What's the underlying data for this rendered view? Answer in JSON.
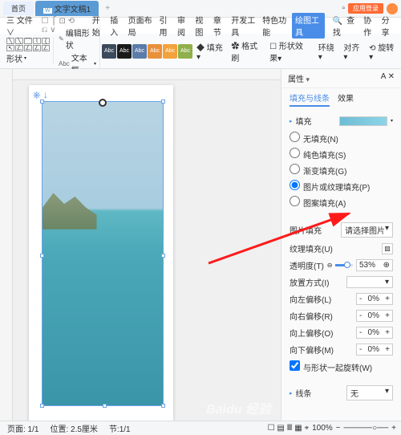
{
  "titlebar": {
    "tab_home": "首页",
    "tab_doc": "文字文稿1",
    "login": "应用登录"
  },
  "menubar": {
    "file": "三 文件 ∨",
    "items": [
      "开始",
      "插入",
      "页面布局",
      "引用",
      "审阅",
      "视图",
      "章节",
      "开发工具",
      "特色功能"
    ],
    "highlight": "绘图工具",
    "search": "查找",
    "collab": "协作",
    "share": "分享"
  },
  "toolbar": {
    "shape": "形状",
    "edit_shape": "编辑形状",
    "textbox": "文本框",
    "fill": "填充",
    "outline": "格式刷",
    "shape_effect": "形状效果",
    "wrap": "环绕",
    "align": "对齐",
    "rotate": "旋转"
  },
  "swatches": [
    "#3b4a5c",
    "#1a1a1a",
    "#5b7ba8",
    "#e8913b",
    "#f2a23a",
    "#8fb04a"
  ],
  "panel": {
    "title": "属性",
    "tabs": [
      "填充与线条",
      "效果"
    ],
    "fill_section": "填充",
    "radios": [
      "无填充(N)",
      "纯色填充(S)",
      "渐变填充(G)",
      "图片或纹理填充(P)",
      "图案填充(A)"
    ],
    "selected_radio": 3,
    "pic_fill": "图片填充",
    "pic_fill_val": "请选择图片",
    "texture": "纹理填充(U)",
    "opacity": "透明度(T)",
    "opacity_val": "53%",
    "tile": "放置方式(I)",
    "off_l": "向左偏移(L)",
    "off_r": "向右偏移(R)",
    "off_u": "向上偏移(O)",
    "off_d": "向下偏移(M)",
    "offset_val": "0%",
    "rotate_chk": "与形状一起旋转(W)",
    "line_section": "线条",
    "line_val": "无"
  },
  "statusbar": {
    "page": "页面: 1/1",
    "pos": "位置: 2.5厘米",
    "sec": "节:1/1",
    "zoom": "100%"
  }
}
